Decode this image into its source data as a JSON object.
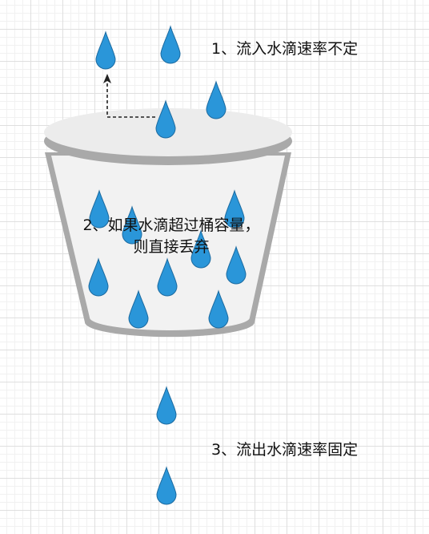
{
  "labels": {
    "inflow": "1、流入水滴速率不定",
    "overflow": "2、如果水滴超过桶容量，则直接丢弃",
    "outflow": "3、流出水滴速率固定"
  },
  "colors": {
    "drop_fill": "#2a96d9",
    "drop_stroke": "#1b6aa0",
    "bucket_body": "#f2f2f2",
    "bucket_rim": "#ececec",
    "bucket_edge": "#a9a9a9",
    "grid_line": "#dfdfdf",
    "arrow": "#222222"
  }
}
